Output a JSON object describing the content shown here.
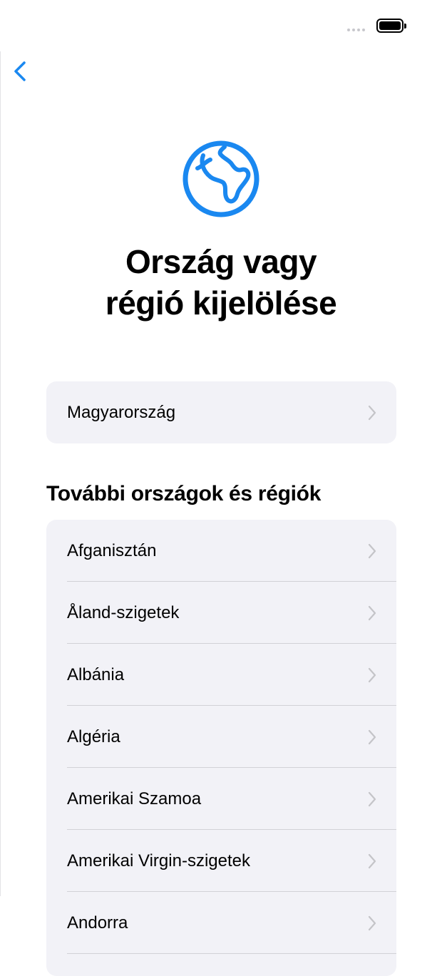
{
  "title": {
    "line1": "Ország vagy",
    "line2": "régió kijelölése"
  },
  "current_region": {
    "label": "Magyarország"
  },
  "section_title": "További országok és régiók",
  "regions": [
    {
      "label": "Afganisztán"
    },
    {
      "label": "Åland-szigetek"
    },
    {
      "label": "Albánia"
    },
    {
      "label": "Algéria"
    },
    {
      "label": "Amerikai Szamoa"
    },
    {
      "label": "Amerikai Virgin-szigetek"
    },
    {
      "label": "Andorra"
    }
  ],
  "colors": {
    "accent": "#1a88f0",
    "row_bg": "#f2f2f7",
    "chevron": "#c4c4c8",
    "separator": "#d1d1d6"
  },
  "icons": {
    "back": "chevron-left-icon",
    "globe": "globe-africa-icon",
    "row": "chevron-right-icon"
  }
}
